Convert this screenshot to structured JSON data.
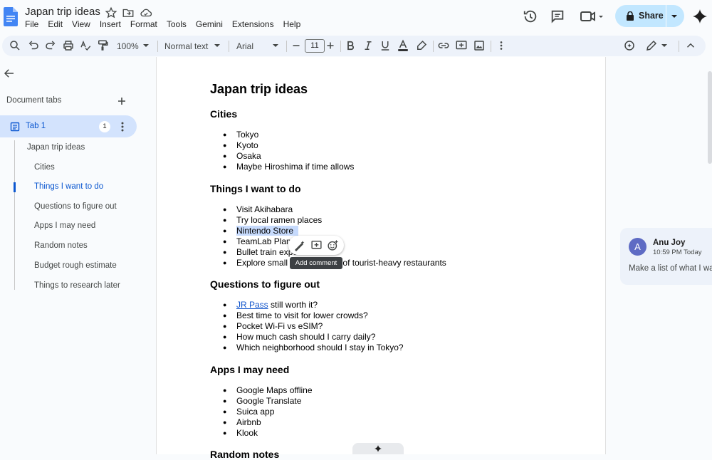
{
  "app": {
    "title": "Japan trip ideas",
    "menu": [
      "File",
      "Edit",
      "View",
      "Insert",
      "Format",
      "Tools",
      "Gemini",
      "Extensions",
      "Help"
    ],
    "share_label": "Share"
  },
  "toolbar": {
    "zoom": "100%",
    "style": "Normal text",
    "font": "Arial",
    "font_size": "11"
  },
  "sidebar": {
    "document_tabs_label": "Document tabs",
    "tab_name": "Tab 1",
    "tab_comment_count": "1",
    "outline": [
      "Japan trip ideas",
      "Cities",
      "Things I want to do",
      "Questions to figure out",
      "Apps I may need",
      "Random notes",
      "Budget rough estimate",
      "Things to research later"
    ],
    "active_outline_index": 2
  },
  "doc": {
    "title": "Japan trip ideas",
    "h_cities": "Cities",
    "cities": [
      "Tokyo",
      "Kyoto",
      "Osaka",
      "Maybe Hiroshima if time allows"
    ],
    "h_things": "Things I want to do",
    "things": [
      "Visit Akihabara",
      "Try local ramen places",
      "Nintendo Store",
      "TeamLab Planets",
      "Bullet train experience",
      "Explore small cafes instead of tourist-heavy restaurants"
    ],
    "h_questions": "Questions to figure out",
    "q_link": "JR Pass",
    "q_link_rest": " still worth it?",
    "questions": [
      "Best time to visit for lower crowds?",
      "Pocket Wi-Fi vs eSIM?",
      "How much cash should I carry daily?",
      "Which neighborhood should I stay in Tokyo?"
    ],
    "h_apps": "Apps I may need",
    "apps": [
      "Google Maps offline",
      "Google Translate",
      "Suica app",
      "Airbnb",
      "Klook"
    ],
    "h_random": "Random notes"
  },
  "tooltip": "Add comment",
  "comment": {
    "avatar_letter": "A",
    "author": "Anu Joy",
    "time": "10:59 PM Today",
    "text": "Make a list of what I want"
  },
  "colors": {
    "accent": "#0b57d0",
    "share_bg": "#c2e7ff",
    "tab_bg": "#d3e3fd",
    "highlight": "#c6dafc",
    "avatar": "#5e6bc4"
  }
}
